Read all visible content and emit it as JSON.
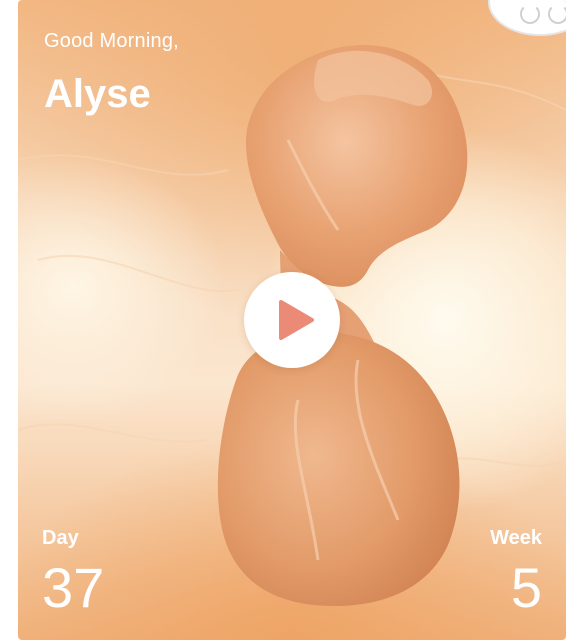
{
  "greeting": "Good Morning,",
  "user_name": "Alyse",
  "day": {
    "label": "Day",
    "value": "37"
  },
  "week": {
    "label": "Week",
    "value": "5"
  },
  "icons": {
    "play": "play-icon",
    "corner": "avatar-badge"
  },
  "colors": {
    "background_warm": "#f2b884",
    "background_light": "#fbe6cf",
    "embryo": "#e8a272",
    "play_triangle": "#ec8a78",
    "text": "#ffffff"
  }
}
